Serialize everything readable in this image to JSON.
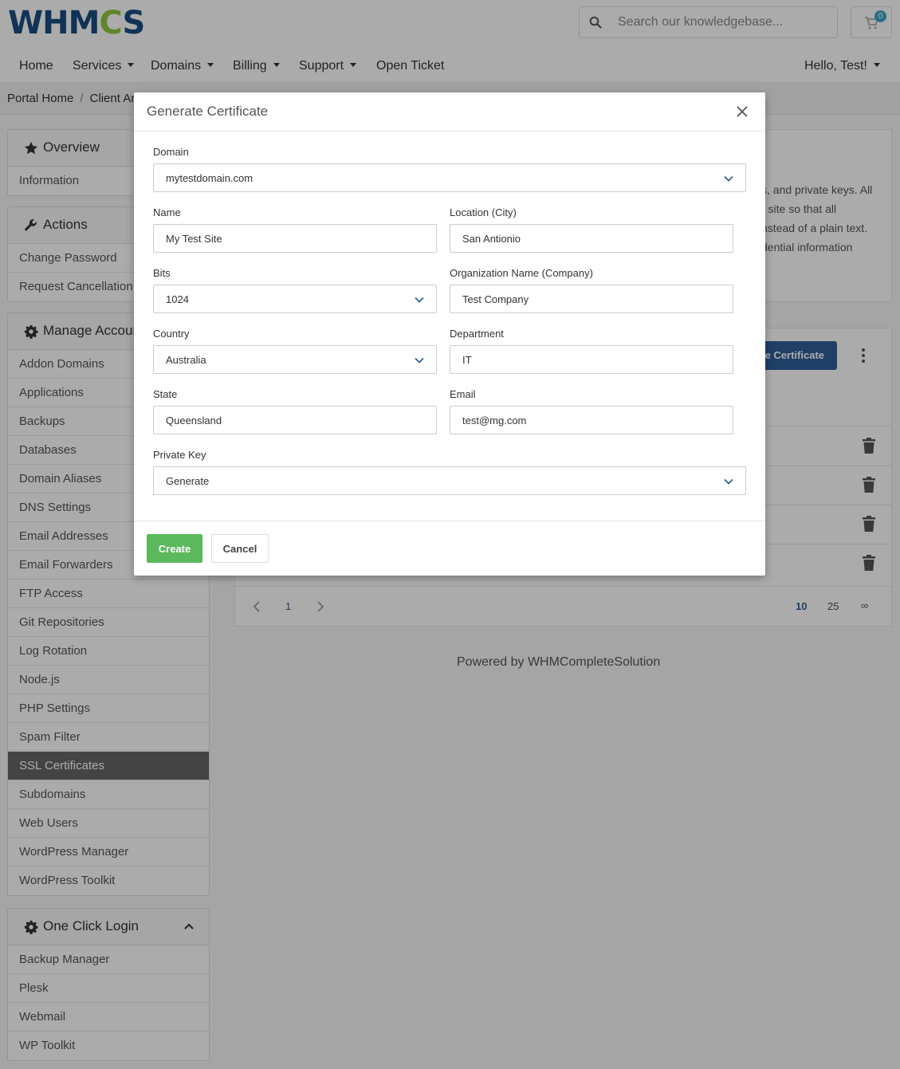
{
  "header": {
    "logo_text_1": "WHM",
    "logo_text_2": "C",
    "logo_text_3": "S",
    "search_placeholder": "Search our knowledgebase...",
    "cart_count": "0",
    "colors": {
      "brand": "#1a4d80",
      "logo_accent": "#8fc640",
      "badge": "#41a6c8"
    }
  },
  "nav": {
    "home": "Home",
    "services": "Services",
    "domains": "Domains",
    "billing": "Billing",
    "support": "Support",
    "open_ticket": "Open Ticket",
    "user": "Hello, Test!"
  },
  "breadcrumb": {
    "home": "Portal Home",
    "current": "Client Area"
  },
  "sidebar": {
    "overview": {
      "title": "Overview",
      "items": [
        "Information"
      ]
    },
    "actions": {
      "title": "Actions",
      "items": [
        "Change Password",
        "Request Cancellation"
      ]
    },
    "manage": {
      "title": "Manage Account",
      "items": [
        "Addon Domains",
        "Applications",
        "Backups",
        "Databases",
        "Domain Aliases",
        "DNS Settings",
        "Email Addresses",
        "Email Forwarders",
        "FTP Access",
        "Git Repositories",
        "Log Rotation",
        "Node.js",
        "PHP Settings",
        "Spam Filter",
        "SSL Certificates",
        "Subdomains",
        "Web Users",
        "WordPress Manager",
        "WordPress Toolkit"
      ],
      "active": "SSL Certificates"
    },
    "one_click": {
      "title": "One Click Login",
      "items": [
        "Backup Manager",
        "Plesk",
        "Webmail",
        "WP Toolkit"
      ]
    }
  },
  "main": {
    "description_lines": [
      "s, and private keys. All",
      "r site so that all",
      "nstead of a plain text.",
      "dential information"
    ],
    "generate_button": "te Certificate",
    "pager": {
      "page": "1",
      "sizes": [
        "10",
        "25",
        "∞"
      ]
    },
    "footer": "Powered by WHMCompleteSolution"
  },
  "modal": {
    "title": "Generate Certificate",
    "domain": {
      "label": "Domain",
      "value": "mytestdomain.com"
    },
    "name": {
      "label": "Name",
      "value": "My Test Site"
    },
    "city": {
      "label": "Location (City)",
      "value": "San Antionio"
    },
    "bits": {
      "label": "Bits",
      "value": "1024"
    },
    "org": {
      "label": "Organization Name (Company)",
      "value": "Test Company"
    },
    "country": {
      "label": "Country",
      "value": "Australia"
    },
    "department": {
      "label": "Department",
      "value": "IT"
    },
    "state": {
      "label": "State",
      "value": "Queensland"
    },
    "email": {
      "label": "Email",
      "value": "test@mg.com"
    },
    "private_key": {
      "label": "Private Key",
      "value": "Generate"
    },
    "create_button": "Create",
    "cancel_button": "Cancel",
    "colors": {
      "create": "#5cb85c"
    }
  }
}
